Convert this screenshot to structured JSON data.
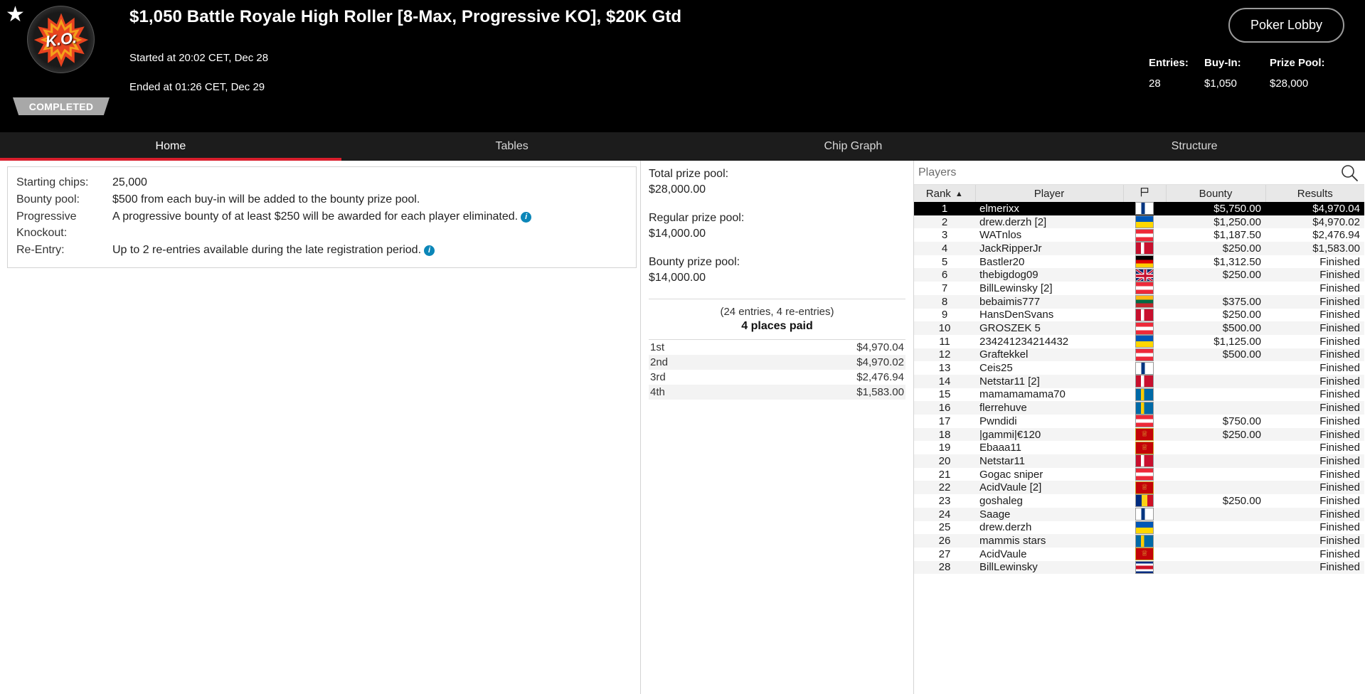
{
  "header": {
    "star_icon": "star-icon",
    "ko_badge_text": "K.O.",
    "status_badge": "COMPLETED",
    "title": "$1,050 Battle Royale High Roller [8-Max, Progressive KO], $20K Gtd",
    "started_at": "Started at 20:02 CET, Dec 28",
    "ended_at": "Ended at 01:26 CET, Dec 29",
    "lobby_button": "Poker Lobby",
    "stats": [
      {
        "label": "Entries:",
        "value": "28"
      },
      {
        "label": "Buy-In:",
        "value": "$1,050"
      },
      {
        "label": "Prize Pool:",
        "value": "$28,000"
      }
    ]
  },
  "tabs": [
    {
      "label": "Home",
      "active": true
    },
    {
      "label": "Tables",
      "active": false
    },
    {
      "label": "Chip Graph",
      "active": false
    },
    {
      "label": "Structure",
      "active": false
    }
  ],
  "info": {
    "rows": [
      {
        "label": "Starting chips:",
        "value": "25,000",
        "info_icon": false
      },
      {
        "label": "Bounty pool:",
        "value": "$500 from each buy-in will be added to the bounty prize pool.",
        "info_icon": false
      },
      {
        "label": "Progressive Knockout:",
        "value": "A progressive bounty of at least $250 will be awarded for each player eliminated.",
        "info_icon": true
      },
      {
        "label": "Re-Entry:",
        "value": "Up to 2 re-entries available during the late registration period.",
        "info_icon": true
      }
    ]
  },
  "prize": {
    "groups": [
      {
        "label": "Total prize pool:",
        "value": "$28,000.00"
      },
      {
        "label": "Regular prize pool:",
        "value": "$14,000.00"
      },
      {
        "label": "Bounty prize pool:",
        "value": "$14,000.00"
      }
    ],
    "entries_note": "(24 entries, 4 re-entries)",
    "places_paid": "4 places paid",
    "payouts": [
      {
        "place": "1st",
        "amount": "$4,970.04"
      },
      {
        "place": "2nd",
        "amount": "$4,970.02"
      },
      {
        "place": "3rd",
        "amount": "$2,476.94"
      },
      {
        "place": "4th",
        "amount": "$1,583.00"
      }
    ]
  },
  "players_panel": {
    "search_placeholder": "Players",
    "search_value": "",
    "search_icon": "search-icon",
    "columns": [
      {
        "key": "rank",
        "label": "Rank",
        "sorted": "asc"
      },
      {
        "key": "player",
        "label": "Player"
      },
      {
        "key": "flag",
        "label": "flag-icon"
      },
      {
        "key": "bounty",
        "label": "Bounty"
      },
      {
        "key": "results",
        "label": "Results"
      }
    ],
    "rows": [
      {
        "rank": "1",
        "player": "elmerixx",
        "country": "fi",
        "bounty": "$5,750.00",
        "results": "$4,970.04",
        "selected": true
      },
      {
        "rank": "2",
        "player": "drew.derzh [2]",
        "country": "ua",
        "bounty": "$1,250.00",
        "results": "$4,970.02",
        "selected": false
      },
      {
        "rank": "3",
        "player": "WATnlos",
        "country": "at",
        "bounty": "$1,187.50",
        "results": "$2,476.94",
        "selected": false
      },
      {
        "rank": "4",
        "player": "JackRipperJr",
        "country": "dk",
        "bounty": "$250.00",
        "results": "$1,583.00",
        "selected": false
      },
      {
        "rank": "5",
        "player": "Bastler20",
        "country": "de",
        "bounty": "$1,312.50",
        "results": "Finished",
        "selected": false
      },
      {
        "rank": "6",
        "player": "thebigdog09",
        "country": "gb",
        "bounty": "$250.00",
        "results": "Finished",
        "selected": false
      },
      {
        "rank": "7",
        "player": "BillLewinsky [2]",
        "country": "at",
        "bounty": "",
        "results": "Finished",
        "selected": false
      },
      {
        "rank": "8",
        "player": "bebaimis777",
        "country": "lt",
        "bounty": "$375.00",
        "results": "Finished",
        "selected": false
      },
      {
        "rank": "9",
        "player": "HansDenSvans",
        "country": "dk",
        "bounty": "$250.00",
        "results": "Finished",
        "selected": false
      },
      {
        "rank": "10",
        "player": "GROSZEK 5",
        "country": "at",
        "bounty": "$500.00",
        "results": "Finished",
        "selected": false
      },
      {
        "rank": "11",
        "player": "234241234214432",
        "country": "ua",
        "bounty": "$1,125.00",
        "results": "Finished",
        "selected": false
      },
      {
        "rank": "12",
        "player": "Graftekkel",
        "country": "at",
        "bounty": "$500.00",
        "results": "Finished",
        "selected": false
      },
      {
        "rank": "13",
        "player": "Ceis25",
        "country": "fi",
        "bounty": "",
        "results": "Finished",
        "selected": false
      },
      {
        "rank": "14",
        "player": "Netstar11 [2]",
        "country": "dk",
        "bounty": "",
        "results": "Finished",
        "selected": false
      },
      {
        "rank": "15",
        "player": "mamamamama70",
        "country": "se",
        "bounty": "",
        "results": "Finished",
        "selected": false
      },
      {
        "rank": "16",
        "player": "flerrehuve",
        "country": "se",
        "bounty": "",
        "results": "Finished",
        "selected": false
      },
      {
        "rank": "17",
        "player": "Pwndidi",
        "country": "at",
        "bounty": "$750.00",
        "results": "Finished",
        "selected": false
      },
      {
        "rank": "18",
        "player": "|gammi|€120",
        "country": "me",
        "bounty": "$250.00",
        "results": "Finished",
        "selected": false
      },
      {
        "rank": "19",
        "player": "Ebaaa11",
        "country": "me",
        "bounty": "",
        "results": "Finished",
        "selected": false
      },
      {
        "rank": "20",
        "player": "Netstar11",
        "country": "dk",
        "bounty": "",
        "results": "Finished",
        "selected": false
      },
      {
        "rank": "21",
        "player": "Gogac sniper",
        "country": "at",
        "bounty": "",
        "results": "Finished",
        "selected": false
      },
      {
        "rank": "22",
        "player": "AcidVaule [2]",
        "country": "me",
        "bounty": "",
        "results": "Finished",
        "selected": false
      },
      {
        "rank": "23",
        "player": "goshaleg",
        "country": "ro",
        "bounty": "$250.00",
        "results": "Finished",
        "selected": false
      },
      {
        "rank": "24",
        "player": "Saage",
        "country": "fi",
        "bounty": "",
        "results": "Finished",
        "selected": false
      },
      {
        "rank": "25",
        "player": "drew.derzh",
        "country": "ua",
        "bounty": "",
        "results": "Finished",
        "selected": false
      },
      {
        "rank": "26",
        "player": "mammis stars",
        "country": "se",
        "bounty": "",
        "results": "Finished",
        "selected": false
      },
      {
        "rank": "27",
        "player": "AcidVaule",
        "country": "me",
        "bounty": "",
        "results": "Finished",
        "selected": false
      },
      {
        "rank": "28",
        "player": "BillLewinsky",
        "country": "cr",
        "bounty": "",
        "results": "Finished",
        "selected": false
      }
    ]
  },
  "colors": {
    "accent_red": "#d91f2d",
    "header_bg": "#000000",
    "tabbar_bg": "#1c1c1c",
    "info_icon": "#0b86b8",
    "selected_row": "#000000"
  }
}
